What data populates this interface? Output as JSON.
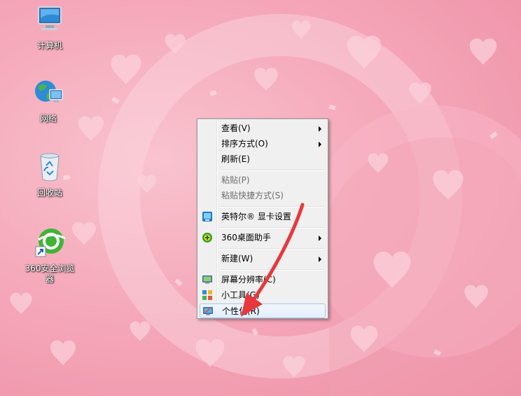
{
  "desktop": {
    "icons": [
      {
        "label": "计算机",
        "icon": "computer-icon"
      },
      {
        "label": "网络",
        "icon": "network-icon"
      },
      {
        "label": "回收站",
        "icon": "recycle-bin-icon"
      },
      {
        "label": "360安全浏览器",
        "icon": "browser-360-icon"
      }
    ]
  },
  "context_menu": {
    "items": [
      {
        "label": "查看(V)",
        "submenu": true,
        "enabled": true
      },
      {
        "label": "排序方式(O)",
        "submenu": true,
        "enabled": true
      },
      {
        "label": "刷新(E)",
        "enabled": true
      },
      {
        "label": "粘贴(P)",
        "enabled": false
      },
      {
        "label": "粘贴快捷方式(S)",
        "enabled": false
      },
      {
        "label": "英特尔® 显卡设置",
        "icon": "intel-graphics-icon",
        "enabled": true
      },
      {
        "label": "360桌面助手",
        "icon": "desktop-helper-360-icon",
        "submenu": true,
        "enabled": true
      },
      {
        "label": "新建(W)",
        "submenu": true,
        "enabled": true
      },
      {
        "label": "屏幕分辨率(C)",
        "icon": "screen-resolution-icon",
        "enabled": true
      },
      {
        "label": "小工具(G)",
        "icon": "gadgets-icon",
        "enabled": true
      },
      {
        "label": "个性化(R)",
        "icon": "personalize-icon",
        "enabled": true,
        "highlighted": true
      }
    ]
  },
  "colors": {
    "wallpaper_base": "#f5a9ba",
    "heart": "#fbd3dc",
    "annotation_arrow": "#e8383d",
    "menu_bg": "#f0f0f0"
  }
}
